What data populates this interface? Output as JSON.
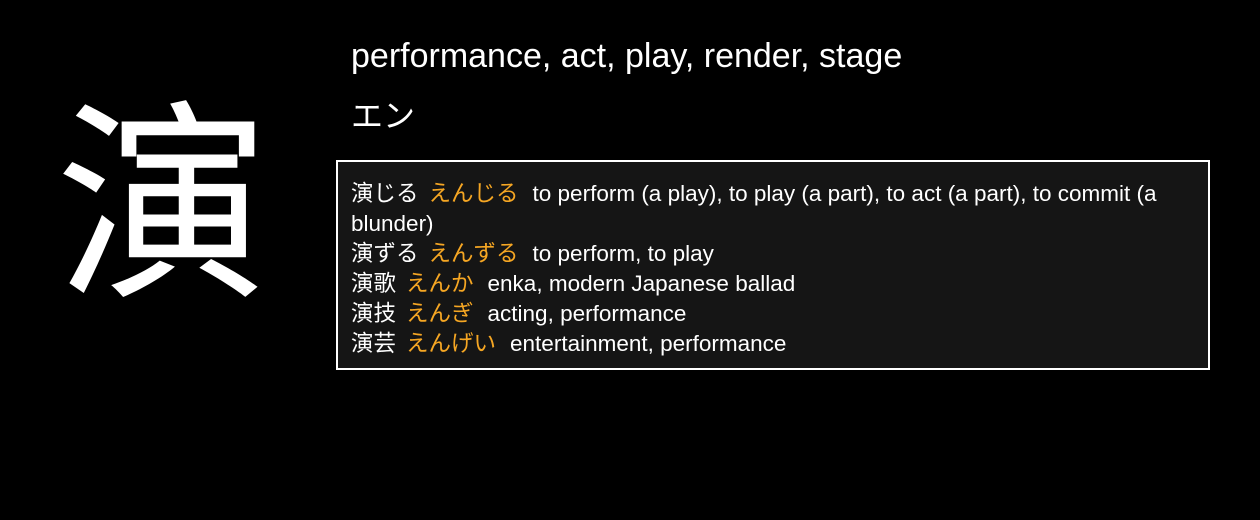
{
  "kanji": "演",
  "meaning": "performance, act, play, render, stage",
  "reading": "エン",
  "colors": {
    "background": "#000000",
    "text": "#ffffff",
    "kana": "#f5a623",
    "box_background": "#151515",
    "box_border": "#ffffff"
  },
  "vocab": [
    {
      "word": "演じる",
      "kana": "えんじる",
      "definition": "to perform (a play), to play (a part), to act (a part), to commit (a blunder)"
    },
    {
      "word": "演ずる",
      "kana": "えんずる",
      "definition": "to perform, to play"
    },
    {
      "word": "演歌",
      "kana": "えんか",
      "definition": "enka, modern Japanese ballad"
    },
    {
      "word": "演技",
      "kana": "えんぎ",
      "definition": "acting, performance"
    },
    {
      "word": "演芸",
      "kana": "えんげい",
      "definition": "entertainment, performance"
    }
  ]
}
